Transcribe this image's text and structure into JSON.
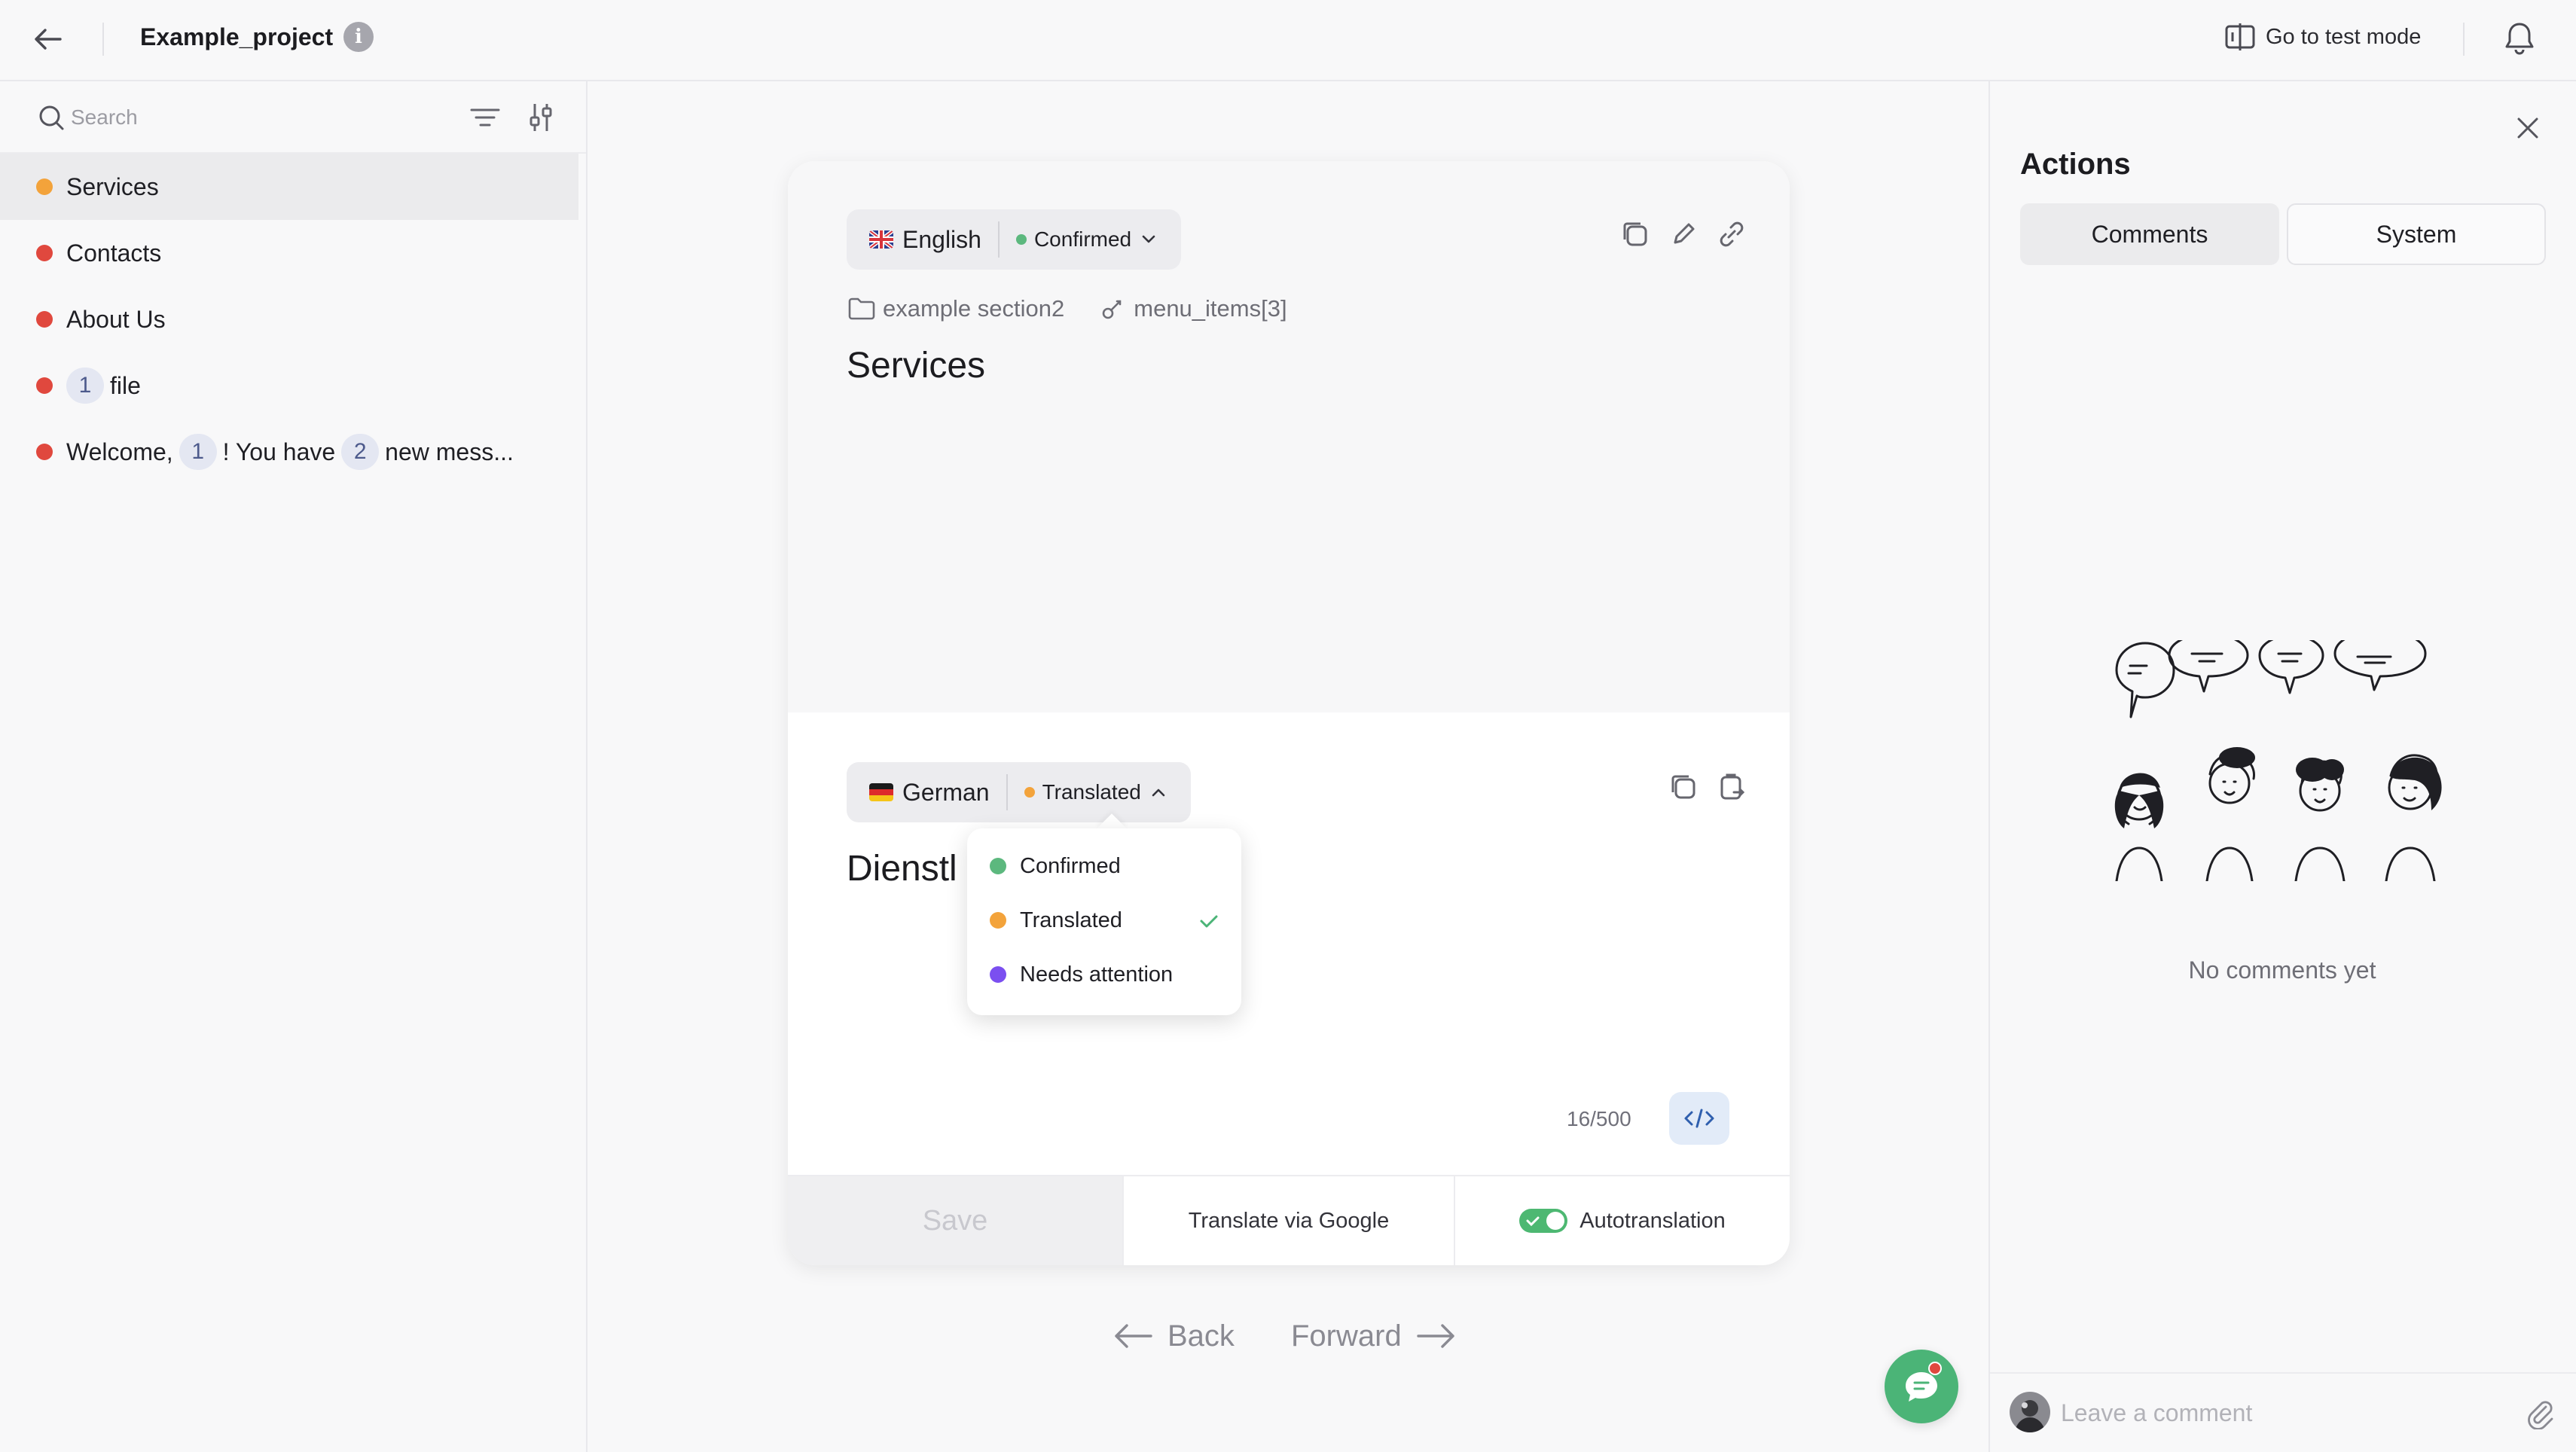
{
  "header": {
    "project_name": "Example_project",
    "info_glyph": "i",
    "test_mode_label": "Go to test mode"
  },
  "sidebar": {
    "search_placeholder": "Search",
    "items": [
      {
        "text": "Services",
        "status_color": "#f3a33b",
        "active": true
      },
      {
        "text": "Contacts",
        "status_color": "#e0483e"
      },
      {
        "text": "About Us",
        "status_color": "#e0483e"
      },
      {
        "var1": "1",
        "text_after": "file",
        "status_color": "#e0483e"
      },
      {
        "text_before": "Welcome,",
        "var1": "1",
        "text_mid": "! You have",
        "var2": "2",
        "text_after": "new mess...",
        "status_color": "#e0483e"
      }
    ]
  },
  "editor": {
    "source": {
      "language": "English",
      "status": "Confirmed",
      "status_color": "#5cb87e",
      "section": "example section2",
      "key": "menu_items[3]",
      "text": "Services"
    },
    "target": {
      "language": "German",
      "status": "Translated",
      "status_color": "#f3a33b",
      "text": "Dienstl",
      "counter": "16/500"
    },
    "footer": {
      "save_label": "Save",
      "translate_label": "Translate via Google",
      "autotranslation_label": "Autotranslation",
      "autotranslation_on": true
    },
    "status_options": [
      {
        "label": "Confirmed",
        "color": "#5cb87e"
      },
      {
        "label": "Translated",
        "color": "#f3a33b",
        "selected": true
      },
      {
        "label": "Needs attention",
        "color": "#7b4ff0"
      }
    ],
    "nav": {
      "back_label": "Back",
      "forward_label": "Forward"
    }
  },
  "actions_panel": {
    "title": "Actions",
    "tabs": [
      {
        "label": "Comments",
        "active": true
      },
      {
        "label": "System"
      }
    ],
    "empty_text": "No comments yet",
    "comment_placeholder": "Leave a comment"
  },
  "colors": {
    "accent_green": "#4bb477",
    "status_red": "#e0483e",
    "status_orange": "#f3a33b",
    "status_purple": "#7b4ff0"
  }
}
